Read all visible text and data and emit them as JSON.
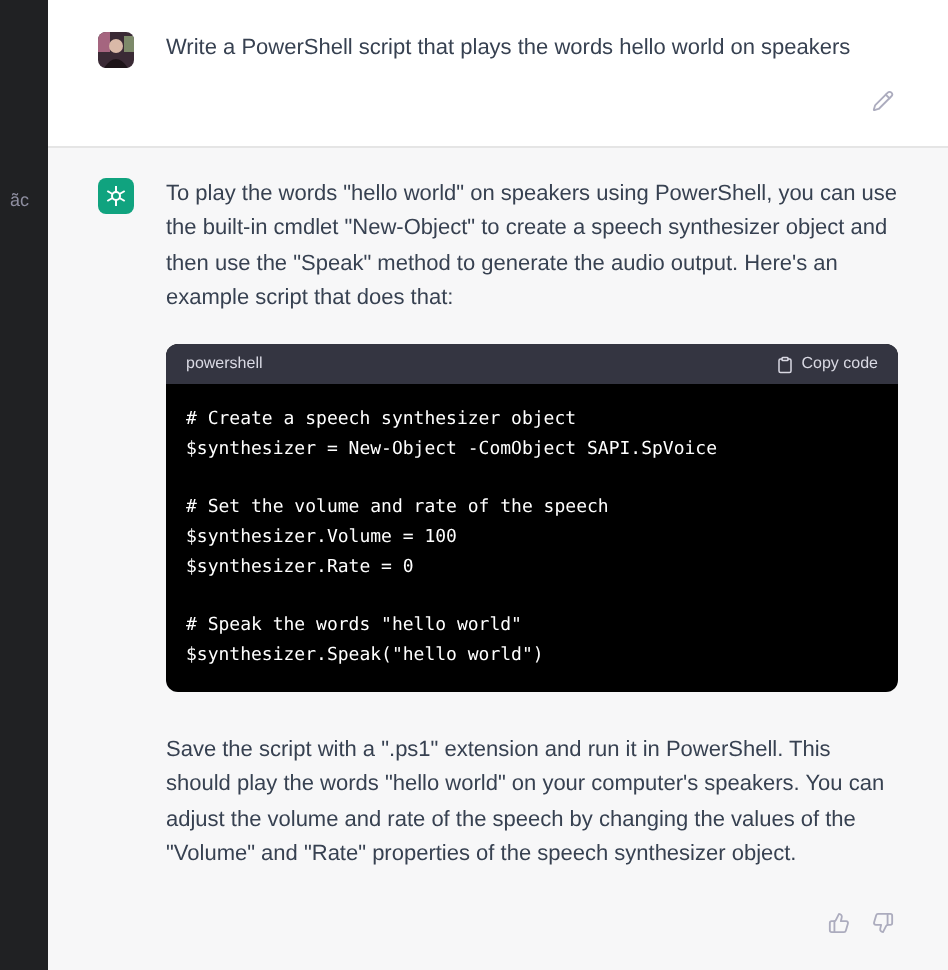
{
  "sidebar": {
    "partial_text": "ãc"
  },
  "user_message": {
    "text": "Write a PowerShell script that plays the words hello world on speakers"
  },
  "assistant_message": {
    "intro": "To play the words \"hello world\" on speakers using PowerShell, you can use the built-in cmdlet \"New-Object\" to create a speech synthesizer object and then use the \"Speak\" method to generate the audio output. Here's an example script that does that:",
    "code_block": {
      "language": "powershell",
      "copy_label": "Copy code",
      "groups": [
        [
          "# Create a speech synthesizer object",
          "$synthesizer = New-Object -ComObject SAPI.SpVoice"
        ],
        [
          "# Set the volume and rate of the speech",
          "$synthesizer.Volume = 100",
          "$synthesizer.Rate = 0"
        ],
        [
          "# Speak the words \"hello world\"",
          "$synthesizer.Speak(\"hello world\")"
        ]
      ]
    },
    "outro": "Save the script with a \".ps1\" extension and run it in PowerShell. This should play the words \"hello world\" on your computer's speakers. You can adjust the volume and rate of the speech by changing the values of the \"Volume\" and \"Rate\" properties of the speech synthesizer object."
  }
}
